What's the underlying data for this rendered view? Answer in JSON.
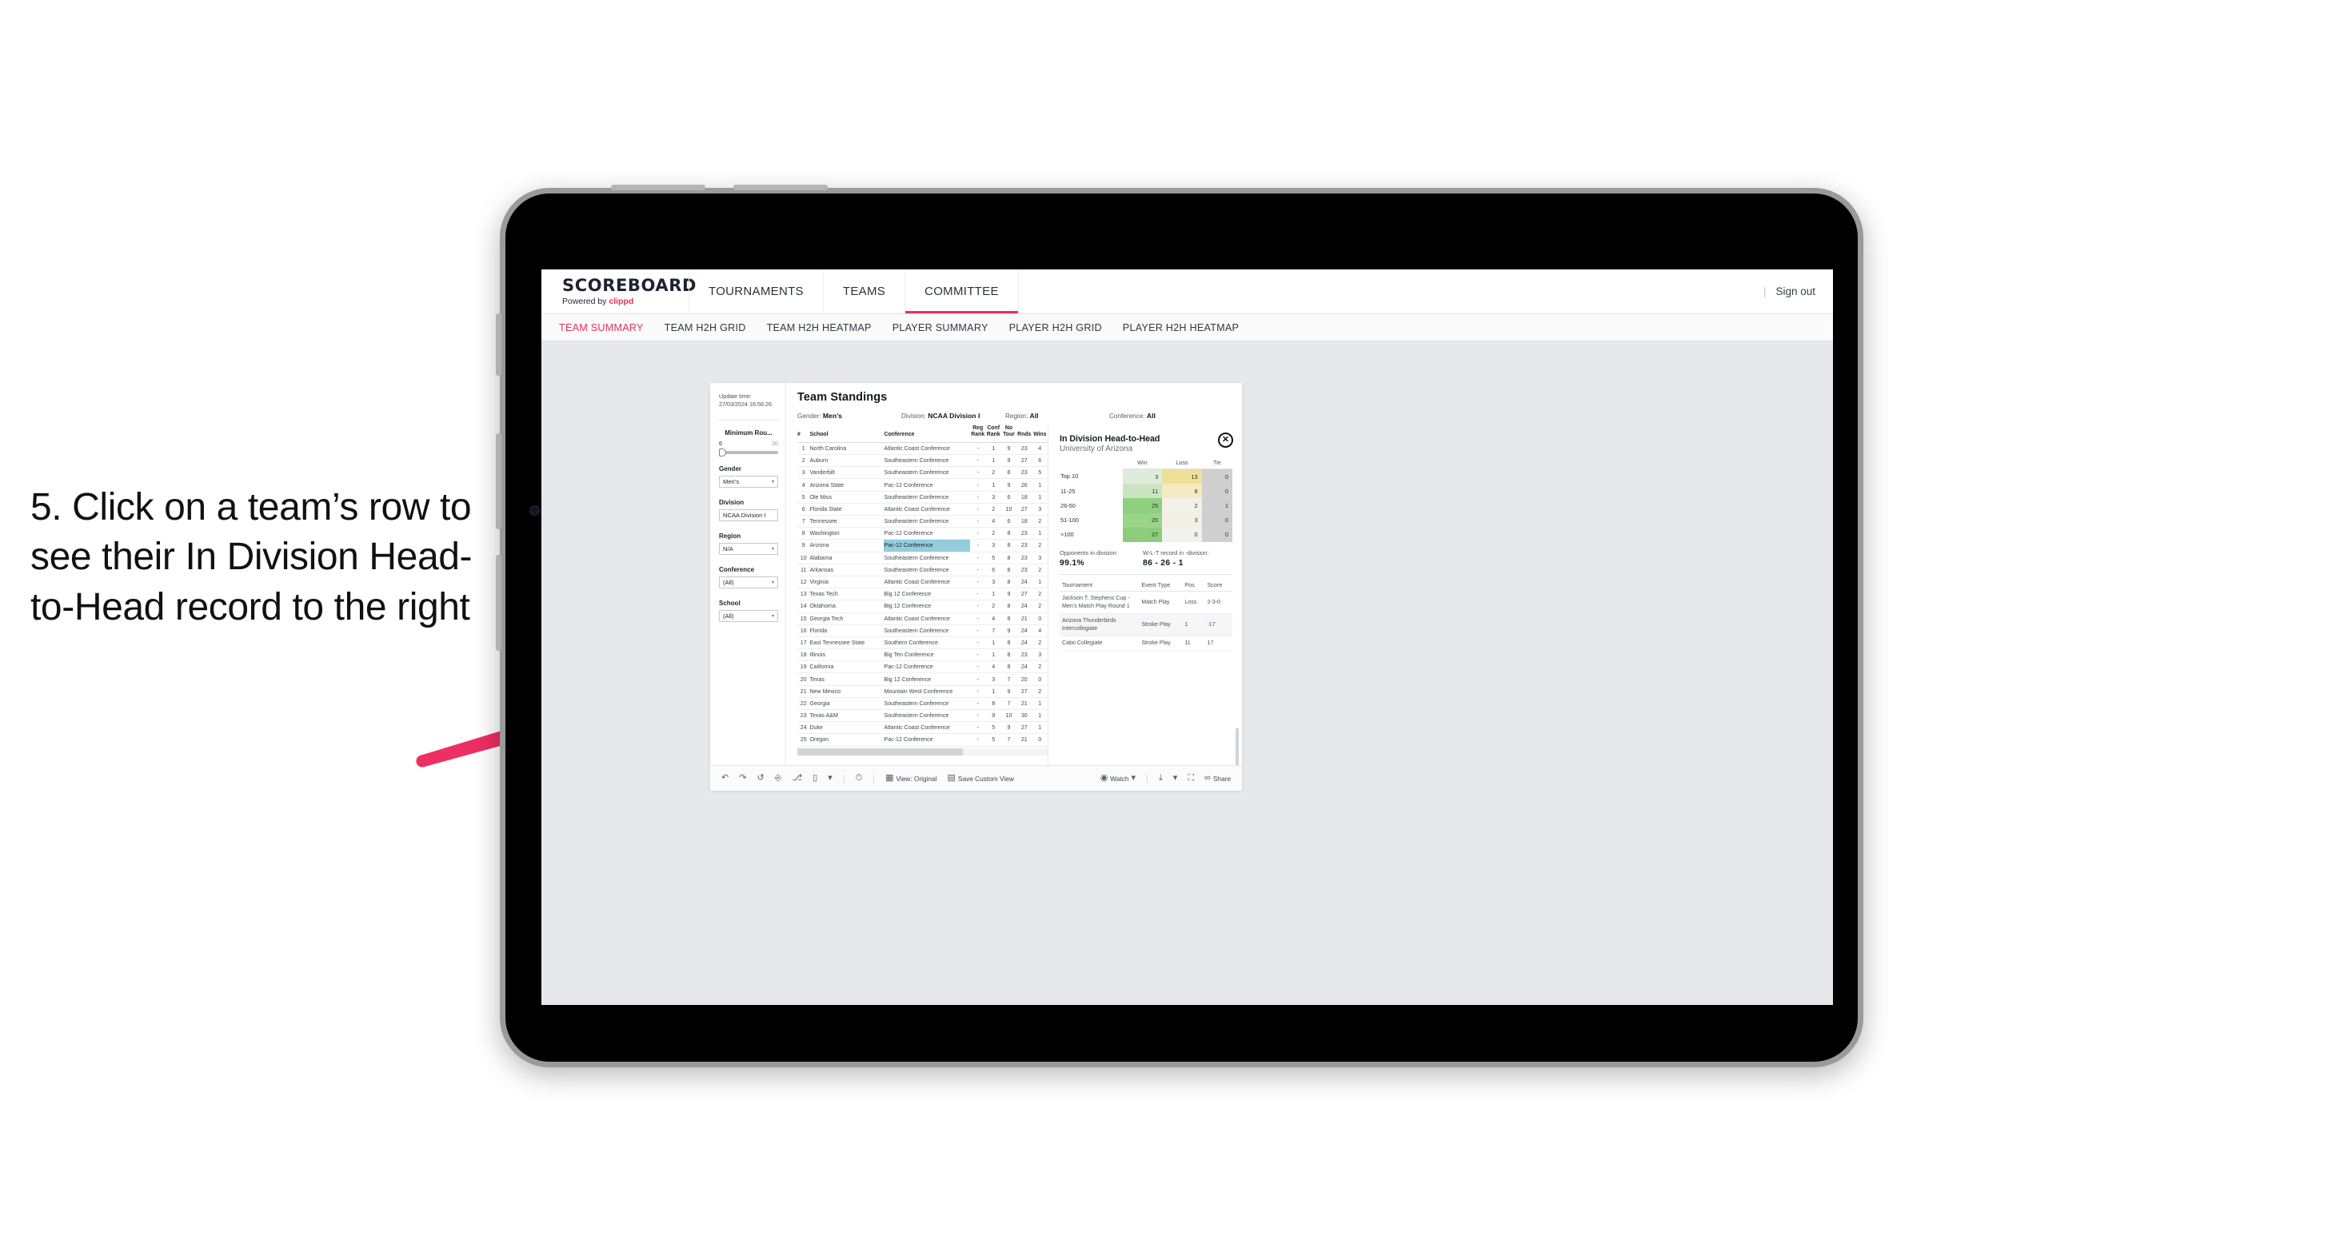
{
  "instruction": {
    "text": "5. Click on a team’s row to see their In Division Head-to-Head record to the right"
  },
  "app": {
    "brand": {
      "logo": "SCOREBOARD",
      "powered_prefix": "Powered by ",
      "powered_name": "clippd"
    },
    "topnav": [
      "TOURNAMENTS",
      "TEAMS",
      "COMMITTEE"
    ],
    "topnav_active": "COMMITTEE",
    "signout": "Sign out",
    "separator": "|",
    "subnav": [
      "TEAM SUMMARY",
      "TEAM H2H GRID",
      "TEAM H2H HEATMAP",
      "PLAYER SUMMARY",
      "PLAYER H2H GRID",
      "PLAYER H2H HEATMAP"
    ],
    "subnav_active": "TEAM SUMMARY"
  },
  "rail": {
    "update_label": "Update time:",
    "update_value": "27/03/2024 16:56:26",
    "min_rounds": {
      "label": "Minimum Rou...",
      "min": "6",
      "max": "30"
    },
    "filters": [
      {
        "label": "Gender",
        "value": "Men’s"
      },
      {
        "label": "Division",
        "value": "NCAA Division I"
      },
      {
        "label": "Region",
        "value": "N/A"
      },
      {
        "label": "Conference",
        "value": "(All)"
      },
      {
        "label": "School",
        "value": "(All)"
      }
    ],
    "caret": "▾"
  },
  "panel": {
    "title": "Team Standings",
    "crumbs": [
      {
        "key": "Gender:",
        "val": "Men’s"
      },
      {
        "key": "Division:",
        "val": "NCAA Division I"
      },
      {
        "key": "Region:",
        "val": "All"
      },
      {
        "key": "Conference:",
        "val": "All"
      }
    ]
  },
  "standings": {
    "headers": [
      "#",
      "School",
      "Conference",
      "Reg Rank",
      "Conf Rank",
      "No Tour",
      "Rnds",
      "Wins"
    ],
    "highlight_row": 9,
    "rows": [
      [
        "1",
        "North Carolina",
        "Atlantic Coast Conference",
        "-",
        "1",
        "9",
        "23",
        "4"
      ],
      [
        "2",
        "Auburn",
        "Southeastern Conference",
        "-",
        "1",
        "9",
        "27",
        "6"
      ],
      [
        "3",
        "Vanderbilt",
        "Southeastern Conference",
        "-",
        "2",
        "8",
        "23",
        "5"
      ],
      [
        "4",
        "Arizona State",
        "Pac-12 Conference",
        "-",
        "1",
        "9",
        "26",
        "1"
      ],
      [
        "5",
        "Ole Miss",
        "Southeastern Conference",
        "-",
        "3",
        "6",
        "18",
        "1"
      ],
      [
        "6",
        "Florida State",
        "Atlantic Coast Conference",
        "-",
        "2",
        "10",
        "27",
        "3"
      ],
      [
        "7",
        "Tennessee",
        "Southeastern Conference",
        "-",
        "4",
        "6",
        "18",
        "2"
      ],
      [
        "8",
        "Washington",
        "Pac-12 Conference",
        "-",
        "2",
        "8",
        "23",
        "1"
      ],
      [
        "9",
        "Arizona",
        "Pac-12 Conference",
        "-",
        "3",
        "8",
        "23",
        "2"
      ],
      [
        "10",
        "Alabama",
        "Southeastern Conference",
        "-",
        "5",
        "8",
        "23",
        "3"
      ],
      [
        "11",
        "Arkansas",
        "Southeastern Conference",
        "-",
        "6",
        "8",
        "23",
        "2"
      ],
      [
        "12",
        "Virginia",
        "Atlantic Coast Conference",
        "-",
        "3",
        "8",
        "24",
        "1"
      ],
      [
        "13",
        "Texas Tech",
        "Big 12 Conference",
        "-",
        "1",
        "9",
        "27",
        "2"
      ],
      [
        "14",
        "Oklahoma",
        "Big 12 Conference",
        "-",
        "2",
        "8",
        "24",
        "2"
      ],
      [
        "15",
        "Georgia Tech",
        "Atlantic Coast Conference",
        "-",
        "4",
        "8",
        "21",
        "0"
      ],
      [
        "16",
        "Florida",
        "Southeastern Conference",
        "-",
        "7",
        "9",
        "24",
        "4"
      ],
      [
        "17",
        "East Tennessee State",
        "Southern Conference",
        "-",
        "1",
        "8",
        "24",
        "2"
      ],
      [
        "18",
        "Illinois",
        "Big Ten Conference",
        "-",
        "1",
        "8",
        "23",
        "3"
      ],
      [
        "19",
        "California",
        "Pac-12 Conference",
        "-",
        "4",
        "8",
        "24",
        "2"
      ],
      [
        "20",
        "Texas",
        "Big 12 Conference",
        "-",
        "3",
        "7",
        "20",
        "0"
      ],
      [
        "21",
        "New Mexico",
        "Mountain West Conference",
        "-",
        "1",
        "9",
        "27",
        "2"
      ],
      [
        "22",
        "Georgia",
        "Southeastern Conference",
        "-",
        "8",
        "7",
        "21",
        "1"
      ],
      [
        "23",
        "Texas A&M",
        "Southeastern Conference",
        "-",
        "9",
        "10",
        "30",
        "1"
      ],
      [
        "24",
        "Duke",
        "Atlantic Coast Conference",
        "-",
        "5",
        "9",
        "27",
        "1"
      ],
      [
        "25",
        "Oregon",
        "Pac-12 Conference",
        "-",
        "5",
        "7",
        "21",
        "0"
      ]
    ]
  },
  "h2h": {
    "title": "In Division Head-to-Head",
    "subtitle": "University of Arizona",
    "close_glyph": "✕",
    "headers": [
      "",
      "Win",
      "Loss",
      "Tie"
    ],
    "rows": [
      {
        "label": "Top 10",
        "win": "3",
        "loss": "13",
        "tie": "0",
        "win_color": "#dfecdc",
        "loss_color": "#f0e096",
        "tie_color": "#cfcfcf"
      },
      {
        "label": "11-25",
        "win": "11",
        "loss": "8",
        "tie": "0",
        "win_color": "#cbe4c2",
        "loss_color": "#f4ebc3",
        "tie_color": "#cfcfcf"
      },
      {
        "label": "26-50",
        "win": "25",
        "loss": "2",
        "tie": "1",
        "win_color": "#8fd07e",
        "loss_color": "#f2f0e7",
        "tie_color": "#cfcfcf"
      },
      {
        "label": "51-100",
        "win": "20",
        "loss": "3",
        "tie": "0",
        "win_color": "#9ad489",
        "loss_color": "#f3efe4",
        "tie_color": "#cfcfcf"
      },
      {
        "label": ">100",
        "win": "27",
        "loss": "0",
        "tie": "0",
        "win_color": "#8ccd7b",
        "loss_color": "#f1f1ef",
        "tie_color": "#cfcfcf"
      }
    ],
    "stats": [
      {
        "label": "Opponents in division:",
        "value": "99.1%"
      },
      {
        "label": "W-L-T record in -division:",
        "value": "86 - 26 - 1"
      }
    ],
    "tournament_headers": [
      "Tournament",
      "Event Type",
      "Pos",
      "Score"
    ],
    "tournaments": [
      {
        "name": "Jackson T. Stephens Cup - Men’s Match Play Round 1",
        "type": "Match Play",
        "pos": "Loss",
        "score": "2-3-0"
      },
      {
        "name": "Arizona Thunderbirds Intercollegiate",
        "type": "Stroke Play",
        "pos": "1",
        "score": "-17"
      },
      {
        "name": "Cabo Collegiate",
        "type": "Stroke Play",
        "pos": "11",
        "score": "17"
      }
    ]
  },
  "toolbar": {
    "icons": [
      "undo-icon",
      "redo-icon",
      "revert-icon",
      "pause-icon",
      "refresh-icon",
      "rectangle-select-icon",
      "caret-icon",
      "clock-icon"
    ],
    "view_label": "View: Original",
    "save_label": "Save Custom View",
    "watch_label": "Watch",
    "share_label": "Share"
  },
  "colors": {
    "accent": "#e8305a",
    "highlight": "#93cddd",
    "app_bg": "#e6e8ec"
  }
}
